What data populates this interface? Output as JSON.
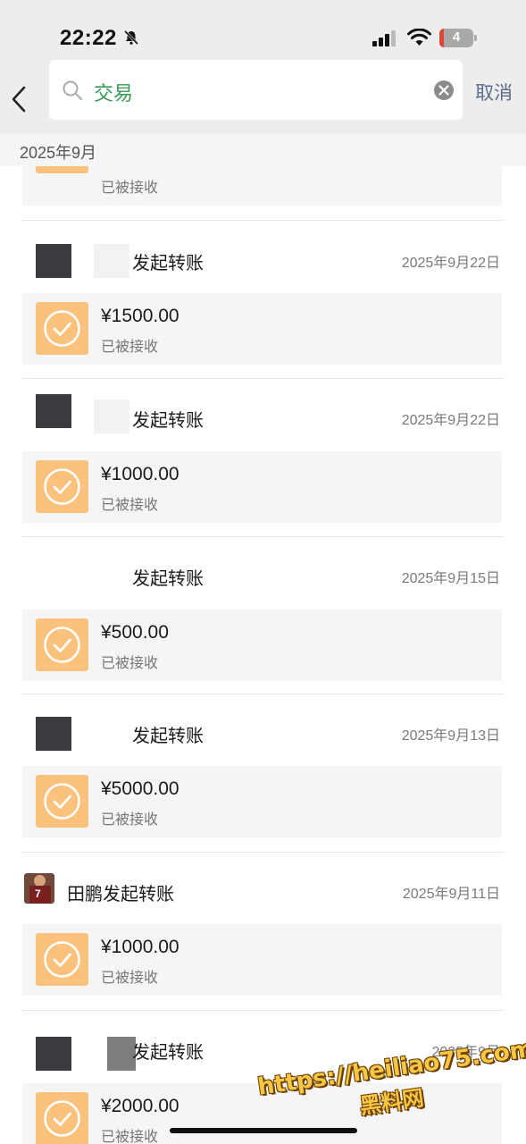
{
  "status_bar": {
    "time": "22:22",
    "battery": "4"
  },
  "search": {
    "value": "交易",
    "cancel_label": "取消"
  },
  "month_header": "2025年9月",
  "partial_item": {
    "status": "已被接收"
  },
  "transactions": [
    {
      "sender": "",
      "action": "发起转账",
      "date": "2025年9月22日",
      "amount": "¥1500.00",
      "status": "已被接收"
    },
    {
      "sender": "",
      "action": "发起转账",
      "date": "2025年9月22日",
      "amount": "¥1000.00",
      "status": "已被接收"
    },
    {
      "sender": "",
      "action": "发起转账",
      "date": "2025年9月15日",
      "amount": "¥500.00",
      "status": "已被接收"
    },
    {
      "sender": "",
      "action": "发起转账",
      "date": "2025年9月13日",
      "amount": "¥5000.00",
      "status": "已被接收"
    },
    {
      "sender": "田鹏",
      "action": "发起转账",
      "date": "2025年9月11日",
      "amount": "¥1000.00",
      "status": "已被接收",
      "avatar_jersey": "7"
    },
    {
      "sender": "",
      "action": "发起转账",
      "date": "2025年9月",
      "amount": "¥2000.00",
      "status": "已被接收"
    }
  ],
  "watermark": {
    "url": "https://heiliao75.com",
    "name": "黑料网"
  },
  "colors": {
    "accent_green": "#3a9a57",
    "link_blue": "#5d6c8e",
    "check_orange": "#fbc27e"
  }
}
